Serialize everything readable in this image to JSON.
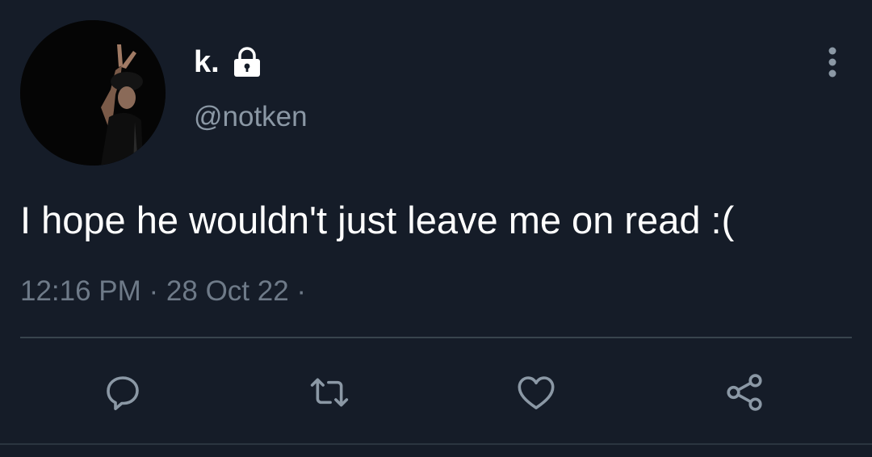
{
  "tweet": {
    "author": {
      "display_name": "k.",
      "handle": "@notken",
      "protected_icon": "lock-icon"
    },
    "text": "I hope he wouldn't just leave me on read :(",
    "time": "12:16 PM",
    "date": "28 Oct 22",
    "meta_separator": " · ",
    "trailing_separator": " ·"
  },
  "actions": [
    {
      "icon": "reply-icon"
    },
    {
      "icon": "retweet-icon"
    },
    {
      "icon": "like-icon"
    },
    {
      "icon": "share-icon"
    }
  ],
  "colors": {
    "background": "#151c28",
    "primary_text": "#ffffff",
    "secondary_text": "#8b98a5",
    "meta_text": "#6e7a88",
    "icon": "#8b98a5",
    "divider": "#38444d"
  }
}
